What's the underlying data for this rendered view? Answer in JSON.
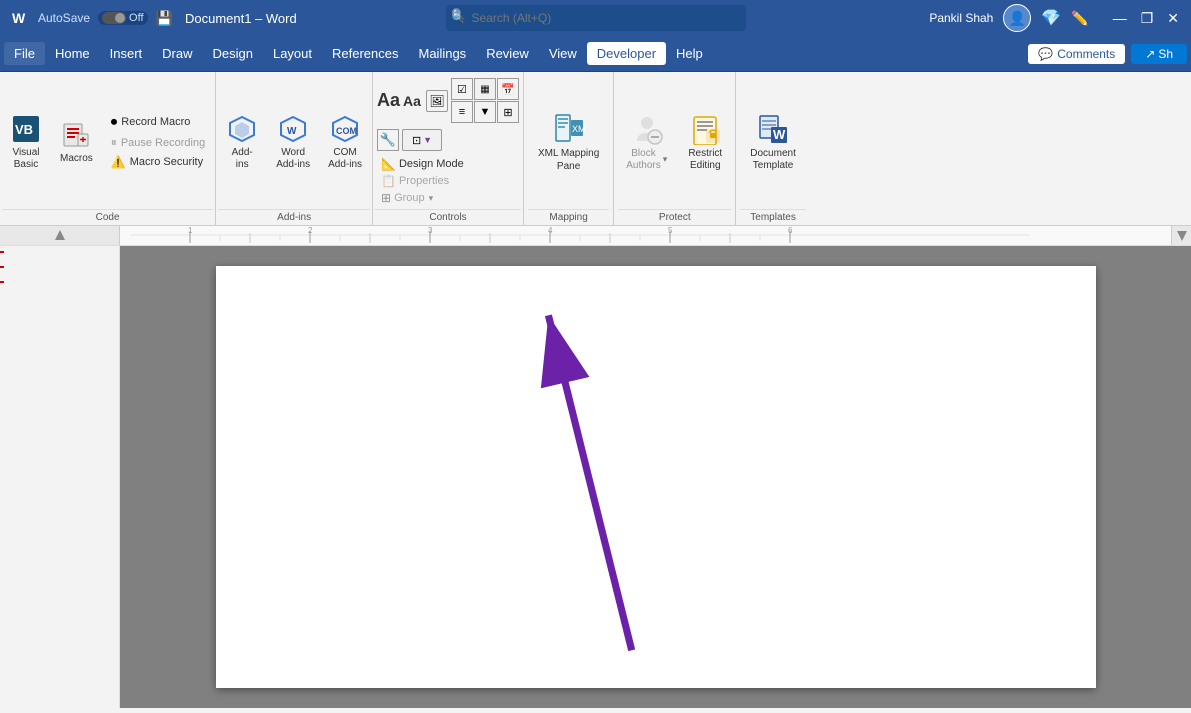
{
  "titlebar": {
    "autosave": "AutoSave",
    "off": "Off",
    "doc_title": "Document1 – Word",
    "search_placeholder": "Search (Alt+Q)",
    "user_name": "Pankil Shah",
    "minimize": "—",
    "restore": "❐",
    "close": "✕"
  },
  "menubar": {
    "items": [
      "File",
      "Home",
      "Insert",
      "Draw",
      "Design",
      "Layout",
      "References",
      "Mailings",
      "Review",
      "View",
      "Developer",
      "Help"
    ],
    "active": "Developer",
    "comments": "Comments",
    "share": "Sh"
  },
  "ribbon": {
    "code_group": {
      "label": "Code",
      "visual_basic": "Visual\nBasic",
      "macros": "Macros",
      "record_macro": "Record Macro",
      "pause_recording": "Pause Recording",
      "macro_security": "Macro Security"
    },
    "addins_group": {
      "label": "Add-ins",
      "addins": "Add-\nins",
      "word_addins": "Word\nAdd-ins",
      "com_addins": "COM\nAdd-ins"
    },
    "controls_group": {
      "label": "Controls",
      "design_mode": "Design Mode",
      "properties": "Properties",
      "group": "Group"
    },
    "mapping_group": {
      "label": "Mapping",
      "xml_mapping": "XML Mapping\nPane"
    },
    "protect_group": {
      "label": "Protect",
      "block_authors": "Block\nAuthors",
      "restrict_editing": "Restrict\nEditing"
    },
    "templates_group": {
      "label": "Templates",
      "document_template": "Document\nTemplate"
    }
  }
}
